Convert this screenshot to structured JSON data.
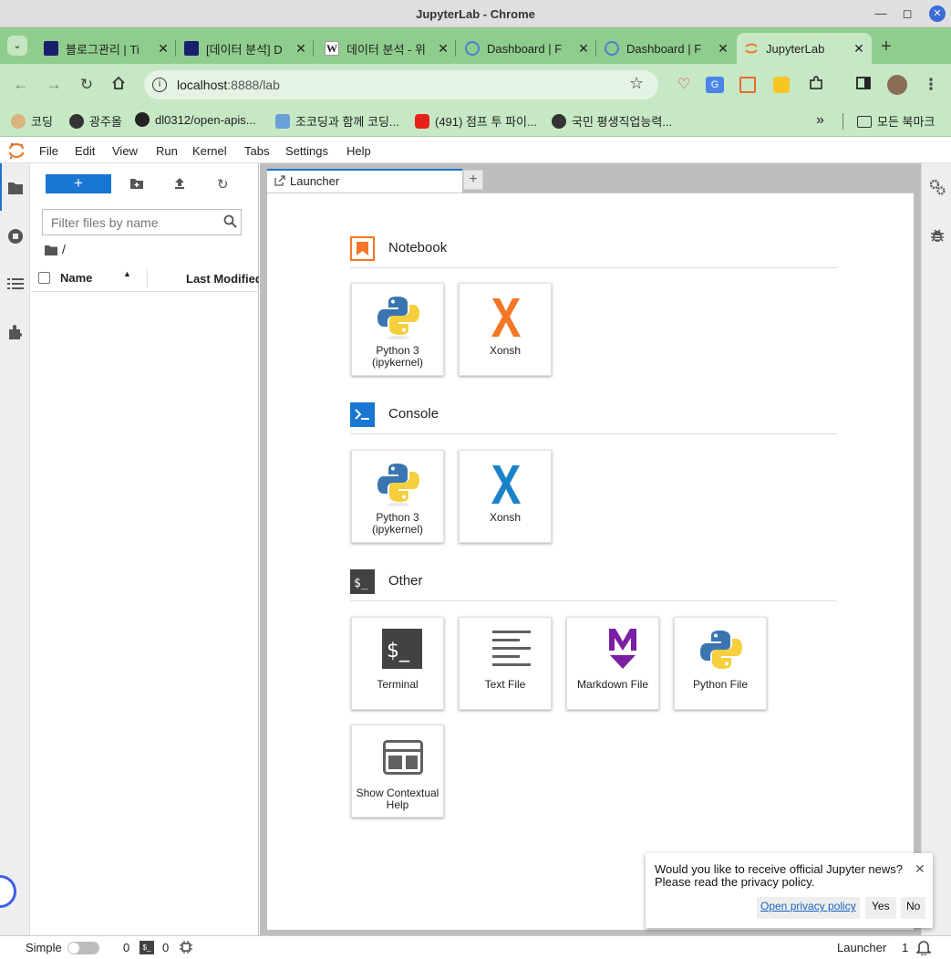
{
  "window": {
    "title": "JupyterLab - Chrome"
  },
  "browser_tabs": [
    {
      "label": "블로그관리 | Ti",
      "icon": "tistory-favicon"
    },
    {
      "label": "[데이터 분석] D",
      "icon": "tistory-favicon"
    },
    {
      "label": "데이터 분석 - 위",
      "icon": "wikipedia-favicon"
    },
    {
      "label": "Dashboard | F",
      "icon": "globe-favicon"
    },
    {
      "label": "Dashboard | F",
      "icon": "globe-favicon"
    },
    {
      "label": "JupyterLab",
      "icon": "jupyter-favicon",
      "active": true
    }
  ],
  "address": {
    "host": "localhost",
    "rest": ":8888/lab"
  },
  "bookmarks": [
    {
      "label": "코딩",
      "icon": "dog-favicon"
    },
    {
      "label": "광주올",
      "icon": "globe-favicon"
    },
    {
      "label": "dl0312/open-apis...",
      "icon": "github-favicon"
    },
    {
      "label": "조코딩과 함께 코딩...",
      "icon": "monitor-favicon"
    },
    {
      "label": "(491) 점프 투 파이...",
      "icon": "youtube-favicon"
    },
    {
      "label": "국민 평생직업능력...",
      "icon": "globe-favicon"
    }
  ],
  "all_bookmarks": "모든 북마크",
  "menu": [
    "File",
    "Edit",
    "View",
    "Run",
    "Kernel",
    "Tabs",
    "Settings",
    "Help"
  ],
  "filebrowser": {
    "filter_placeholder": "Filter files by name",
    "path": "/",
    "col_name": "Name",
    "col_modified": "Last Modified"
  },
  "launcher": {
    "tab_label": "Launcher",
    "sections": {
      "notebook": {
        "title": "Notebook",
        "cards": [
          "Python 3 (ipykernel)",
          "Xonsh"
        ]
      },
      "console": {
        "title": "Console",
        "cards": [
          "Python 3 (ipykernel)",
          "Xonsh"
        ]
      },
      "other": {
        "title": "Other",
        "cards": [
          "Terminal",
          "Text File",
          "Markdown File",
          "Python File",
          "Show Contextual Help"
        ]
      }
    }
  },
  "news_toast": {
    "line1": "Would you like to receive official Jupyter news?",
    "line2": "Please read the privacy policy.",
    "privacy_link": "Open privacy policy",
    "yes": "Yes",
    "no": "No"
  },
  "status": {
    "mode_label": "Simple",
    "kernels": "0",
    "terminals": "0",
    "current": "Launcher",
    "notifications": "1"
  },
  "colors": {
    "accent": "#1976d2",
    "browser_green": "#c6e8c4",
    "jupyter_orange": "#f37726"
  }
}
